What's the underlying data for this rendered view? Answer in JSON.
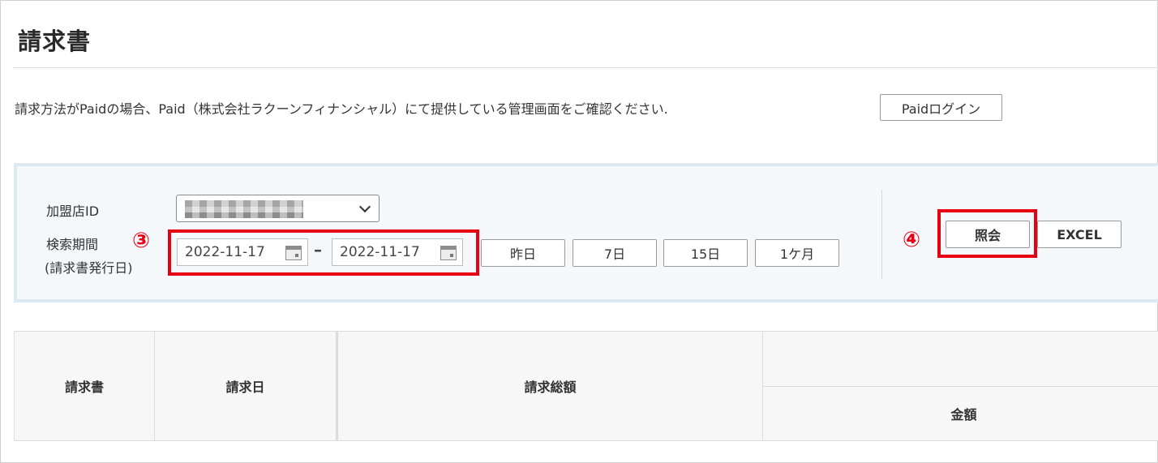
{
  "page": {
    "title": "請求書"
  },
  "notice": {
    "text": "請求方法がPaidの場合、Paid（株式会社ラクーンフィナンシャル）にて提供している管理画面をご確認ください.",
    "login_label": "Paidログイン"
  },
  "search": {
    "merchant_label": "加盟店ID",
    "period_label_line1": "検索期間",
    "period_label_line2": "(請求書発行日)",
    "date_from": "2022-11-17",
    "range_separator": "–",
    "date_to": "2022-11-17",
    "quick_ranges": [
      "昨日",
      "7日",
      "15日",
      "1ケ月"
    ],
    "search_label": "照会",
    "excel_label": "EXCEL"
  },
  "annotations": {
    "step3": "③",
    "step4": "④",
    "color": "#e60012"
  },
  "table": {
    "headers": {
      "invoice": "請求書",
      "invoice_date": "請求日",
      "total": "請求総額",
      "amount": "金額"
    }
  }
}
